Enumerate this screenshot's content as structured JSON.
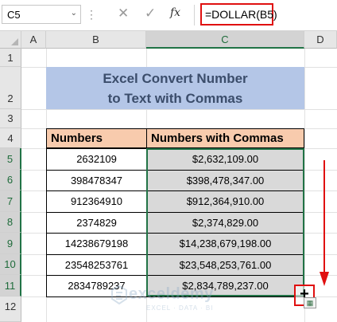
{
  "formula_bar": {
    "name_box": "C5",
    "name_box_arrow": "⌄",
    "separator": "⋮",
    "cancel": "✕",
    "enter": "✓",
    "fx": "fx",
    "formula": "=DOLLAR(B5)"
  },
  "columns": [
    "A",
    "B",
    "C",
    "D"
  ],
  "selected_column": "C",
  "rows": [
    "1",
    "2",
    "3",
    "4",
    "5",
    "6",
    "7",
    "8",
    "9",
    "10",
    "11",
    "12"
  ],
  "selected_rows": [
    "5",
    "6",
    "7",
    "8",
    "9",
    "10",
    "11"
  ],
  "sheet": {
    "title_line1": "Excel Convert Number",
    "title_line2": "to Text with Commas",
    "table": {
      "headers": [
        "Numbers",
        "Numbers with Commas"
      ],
      "rows": [
        [
          "2632109",
          "$2,632,109.00"
        ],
        [
          "398478347",
          "$398,478,347.00"
        ],
        [
          "912364910",
          "$912,364,910.00"
        ],
        [
          "2374829",
          "$2,374,829.00"
        ],
        [
          "14238679198",
          "$14,238,679,198.00"
        ],
        [
          "23548253761",
          "$23,548,253,761.00"
        ],
        [
          "2834789237",
          "$2,834,789,237.00"
        ]
      ]
    }
  },
  "annotations": {
    "fill_handle": "+",
    "arrow_color": "#e01010",
    "box_color": "#e01010"
  },
  "watermark": {
    "name": "exceldemy",
    "tagline": "EXCEL · DATA · BI"
  },
  "colors": {
    "title_fill": "#b4c6e7",
    "header_fill": "#f8cbad",
    "value_fill": "#d9d9d9",
    "selection": "#217346"
  }
}
